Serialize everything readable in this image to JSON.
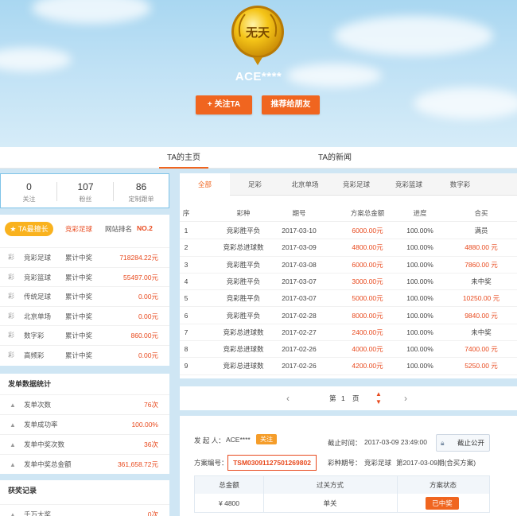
{
  "profile": {
    "medal_text": "无天",
    "nickname": "ACE****",
    "follow_label": "+ 关注TA",
    "recommend_label": "推荐给朋友"
  },
  "main_tabs": [
    {
      "label": "TA的主页",
      "active": true
    },
    {
      "label": "TA的新闻",
      "active": false
    }
  ],
  "stats": [
    {
      "num": "0",
      "label": "关注"
    },
    {
      "num": "107",
      "label": "粉丝"
    },
    {
      "num": "86",
      "label": "定制跟单"
    }
  ],
  "skill": {
    "badge": "TA最擅长",
    "best": "竞彩足球",
    "rank_label": "网站排名",
    "rank": "NO.2",
    "rows": [
      {
        "name": "竞彩足球",
        "kind": "累计中奖",
        "value": "718284.22元"
      },
      {
        "name": "竞彩篮球",
        "kind": "累计中奖",
        "value": "55497.00元"
      },
      {
        "name": "传统足球",
        "kind": "累计中奖",
        "value": "0.00元"
      },
      {
        "name": "北京单场",
        "kind": "累计中奖",
        "value": "0.00元"
      },
      {
        "name": "数字彩",
        "kind": "累计中奖",
        "value": "860.00元"
      },
      {
        "name": "高频彩",
        "kind": "累计中奖",
        "value": "0.00元"
      }
    ]
  },
  "dispatch": {
    "title": "发单数据统计",
    "rows": [
      {
        "label": "发单次数",
        "value": "76次"
      },
      {
        "label": "发单成功率",
        "value": "100.00%"
      },
      {
        "label": "发单中奖次数",
        "value": "36次"
      },
      {
        "label": "发单中奖总金额",
        "value": "361,658.72元"
      }
    ]
  },
  "awards": {
    "title": "获奖记录",
    "rows": [
      {
        "label": "千万大奖",
        "value": "0次"
      }
    ]
  },
  "record_tabs": [
    "全部",
    "足彩",
    "北京单场",
    "竞彩足球",
    "竞彩篮球",
    "数字彩"
  ],
  "table": {
    "headers": [
      "序",
      "彩种",
      "期号",
      "方案总金额",
      "进度",
      "合买"
    ],
    "rows": [
      {
        "no": "1",
        "type": "竞彩胜平负",
        "period": "2017-03-10",
        "amount": "6000.00元",
        "progress": "100.00%",
        "result": "满员",
        "red": false
      },
      {
        "no": "2",
        "type": "竞彩总进球数",
        "period": "2017-03-09",
        "amount": "4800.00元",
        "progress": "100.00%",
        "result": "4880.00 元",
        "red": true
      },
      {
        "no": "3",
        "type": "竞彩胜平负",
        "period": "2017-03-08",
        "amount": "6000.00元",
        "progress": "100.00%",
        "result": "7860.00 元",
        "red": true
      },
      {
        "no": "4",
        "type": "竞彩胜平负",
        "period": "2017-03-07",
        "amount": "3000.00元",
        "progress": "100.00%",
        "result": "未中奖",
        "red": false
      },
      {
        "no": "5",
        "type": "竞彩胜平负",
        "period": "2017-03-07",
        "amount": "5000.00元",
        "progress": "100.00%",
        "result": "10250.00 元",
        "red": true
      },
      {
        "no": "6",
        "type": "竞彩胜平负",
        "period": "2017-02-28",
        "amount": "8000.00元",
        "progress": "100.00%",
        "result": "9840.00 元",
        "red": true
      },
      {
        "no": "7",
        "type": "竞彩总进球数",
        "period": "2017-02-27",
        "amount": "2400.00元",
        "progress": "100.00%",
        "result": "未中奖",
        "red": false
      },
      {
        "no": "8",
        "type": "竞彩总进球数",
        "period": "2017-02-26",
        "amount": "4000.00元",
        "progress": "100.00%",
        "result": "7400.00 元",
        "red": true
      },
      {
        "no": "9",
        "type": "竞彩总进球数",
        "period": "2017-02-26",
        "amount": "4200.00元",
        "progress": "100.00%",
        "result": "5250.00 元",
        "red": true
      }
    ]
  },
  "pager": {
    "page_prefix": "第",
    "page": "1",
    "page_suffix": "页"
  },
  "plan": {
    "initiator_label": "发 起 人：",
    "initiator": "ACE****",
    "follow_tag": "关注",
    "deadline_label": "截止时间：",
    "deadline": "2017-03-09 23:49:00",
    "lock_label": "截止公开",
    "plan_no_label": "方案编号：",
    "plan_no": "TSM03091127501269802",
    "lottery_label": "彩种期号：",
    "lottery": "竞彩足球",
    "period_info": "第2017-03-09期(合买方案)",
    "headers": [
      "总金额",
      "过关方式",
      "方案状态"
    ],
    "amount": "¥ 4800",
    "pass_type": "单关",
    "status": "已中奖"
  },
  "colors": {
    "accent": "#f0651f",
    "win_red": "#e8491d",
    "gold": "#f9b21e"
  }
}
